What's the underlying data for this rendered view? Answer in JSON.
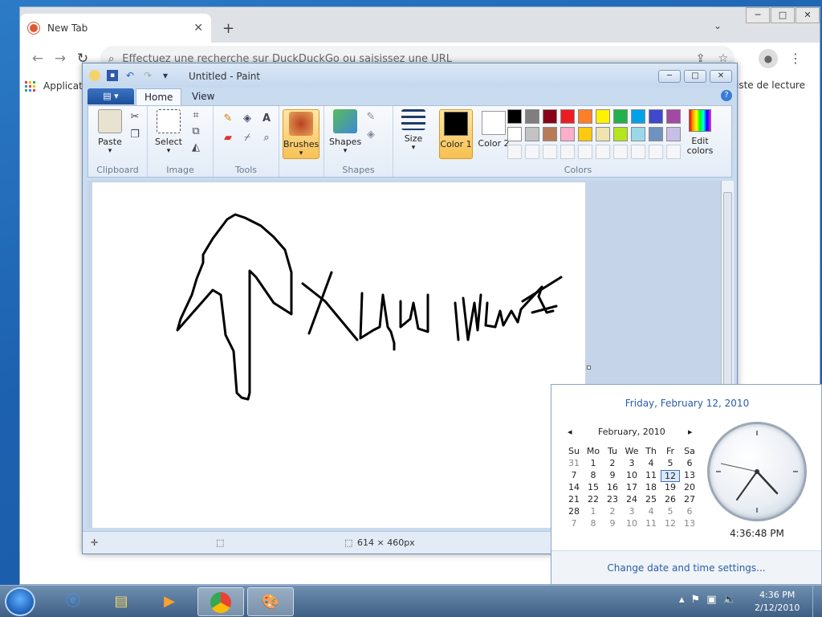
{
  "chrome": {
    "tab_title": "New Tab",
    "omnibox_placeholder": "Effectuez une recherche sur DuckDuckGo ou saisissez une URL",
    "bookmark_apps": "Applicatio",
    "bookmark_reading_list": "iste de lecture"
  },
  "paint": {
    "title": "Untitled - Paint",
    "tabs": {
      "home": "Home",
      "view": "View"
    },
    "groups": {
      "clipboard": "Clipboard",
      "image": "Image",
      "tools": "Tools",
      "shapes": "Shapes",
      "colors": "Colors"
    },
    "buttons": {
      "paste": "Paste",
      "select": "Select",
      "brushes": "Brushes",
      "shapes": "Shapes",
      "size": "Size",
      "color1": "Color 1",
      "color2": "Color 2",
      "edit_colors": "Edit colors"
    },
    "palette": [
      "#000000",
      "#7f7f7f",
      "#880015",
      "#ed1c24",
      "#ff7f27",
      "#fff200",
      "#22b14c",
      "#00a2e8",
      "#3f48cc",
      "#a349a4",
      "#ffffff",
      "#c3c3c3",
      "#b97a57",
      "#ffaec9",
      "#ffc90e",
      "#efe4b0",
      "#b5e61d",
      "#99d9ea",
      "#7092be",
      "#c8bfe7",
      "",
      "",
      "",
      "",
      "",
      "",
      "",
      "",
      "",
      ""
    ],
    "status": {
      "dimensions": "614 × 460px"
    }
  },
  "clock_popup": {
    "header": "Friday, February 12, 2010",
    "month": "February, 2010",
    "weekdays": [
      "Su",
      "Mo",
      "Tu",
      "We",
      "Th",
      "Fr",
      "Sa"
    ],
    "days": [
      [
        "31",
        "1",
        "2",
        "3",
        "4",
        "5",
        "6"
      ],
      [
        "7",
        "8",
        "9",
        "10",
        "11",
        "12",
        "13"
      ],
      [
        "14",
        "15",
        "16",
        "17",
        "18",
        "19",
        "20"
      ],
      [
        "21",
        "22",
        "23",
        "24",
        "25",
        "26",
        "27"
      ],
      [
        "28",
        "1",
        "2",
        "3",
        "4",
        "5",
        "6"
      ],
      [
        "7",
        "8",
        "9",
        "10",
        "11",
        "12",
        "13"
      ]
    ],
    "time": "4:36:48 PM",
    "footer_link": "Change date and time settings..."
  },
  "taskbar": {
    "time": "4:36 PM",
    "date": "2/12/2010"
  }
}
